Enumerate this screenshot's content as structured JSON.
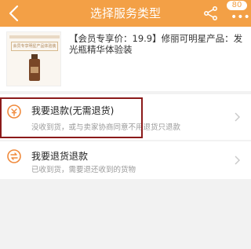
{
  "header": {
    "title": "选择服务类型",
    "badge_count": "80",
    "background_color": "#f3a046",
    "back_icon": "chevron-left-icon",
    "share_icon": "share-icon",
    "more_icon": "more-dots-icon"
  },
  "product": {
    "title": "【会员专享价：19.9】修丽可明星产品：发光瓶精华体验装",
    "thumb_tag": "会员专享明星产品体验装"
  },
  "options": [
    {
      "title": "我要退款(无需退货)",
      "subtitle": "没收到货，或与卖家协商同意不用退货只退款",
      "icon": "refund-icon"
    },
    {
      "title": "我要退货退款",
      "subtitle": "已收到货，需要退还收到的货物",
      "icon": "return-refund-icon"
    }
  ],
  "accent_color": "#f08a3c"
}
